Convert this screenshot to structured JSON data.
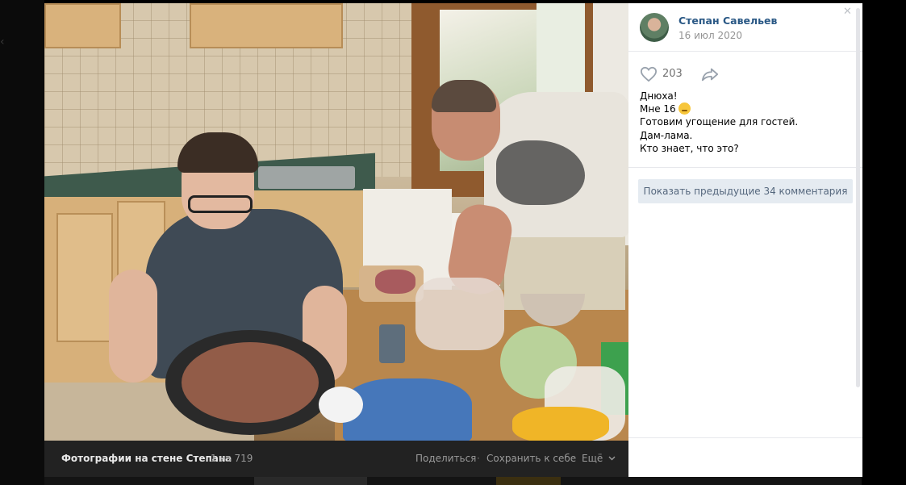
{
  "album": {
    "title": "Фотографии на стене Степана",
    "counter": "1 из 719"
  },
  "actions": {
    "share": "Поделиться",
    "save": "Сохранить к себе",
    "more": "Ещё",
    "separator": "·"
  },
  "author": {
    "name": "Степан Савельев",
    "date": "16 июл 2020"
  },
  "likes": {
    "count": "203"
  },
  "post": {
    "lines": [
      "Днюха!",
      "Мне 16",
      "Готовим угощение для гостей.",
      "Дам-лама.",
      "Кто знает, что это?"
    ]
  },
  "comments": {
    "show_previous": "Показать предыдущие 34 комментария"
  },
  "icons": {
    "like": "heart-icon",
    "share": "share-arrow-icon",
    "more": "chevron-down-icon",
    "close": "close-icon",
    "emoji": "party-face-emoji"
  },
  "colors": {
    "link": "#2a5885",
    "muted": "#939393",
    "button_bg": "#e5ebf1",
    "button_text": "#55677d",
    "bar_bg": "#222222"
  }
}
